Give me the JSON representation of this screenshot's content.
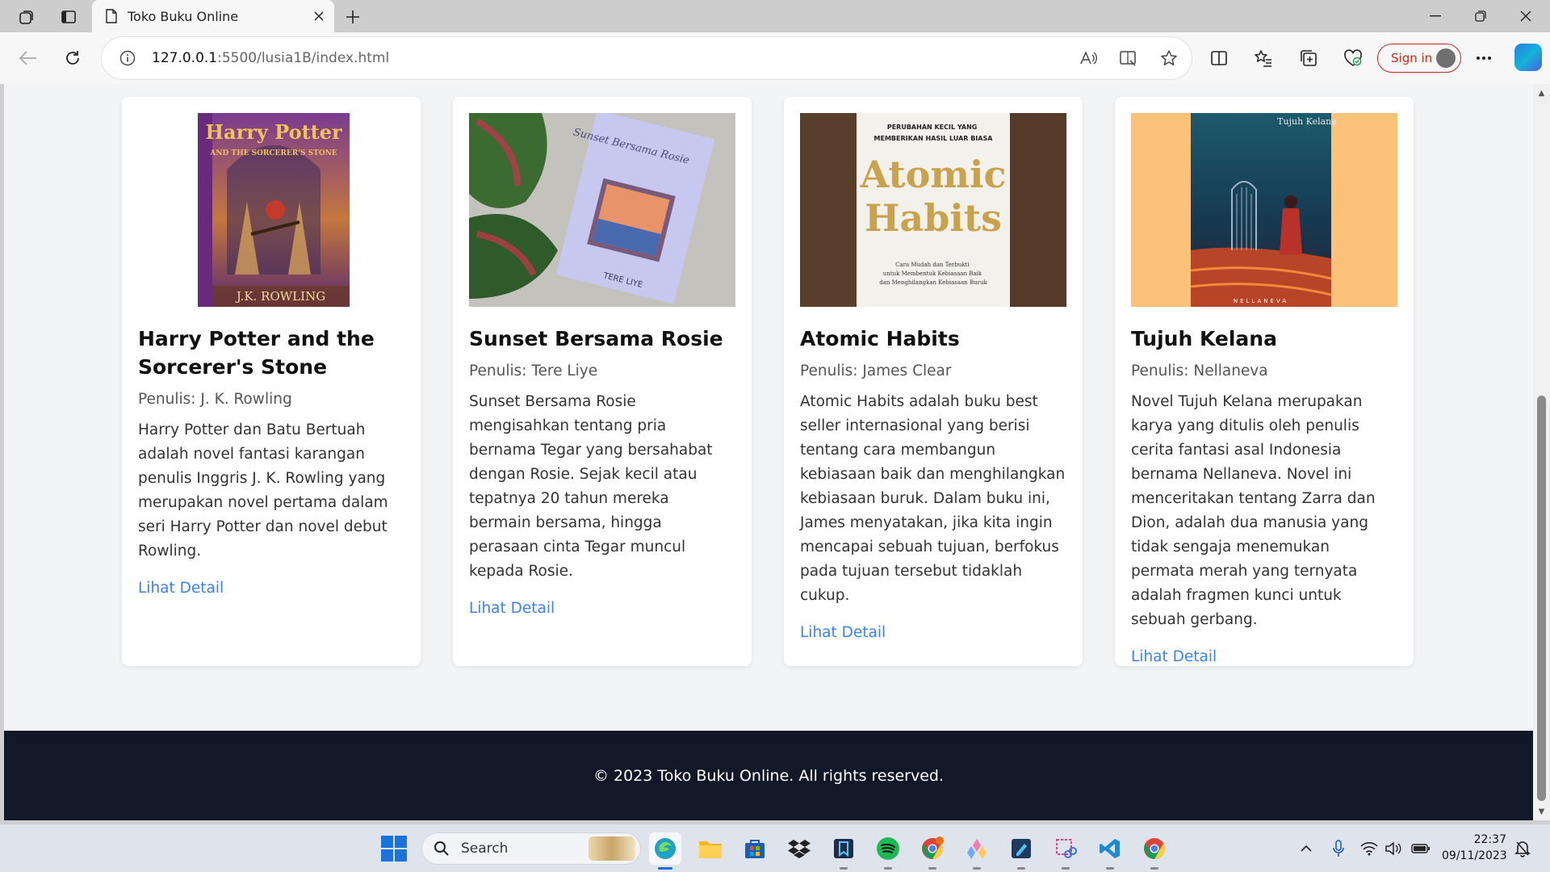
{
  "browser": {
    "tab_title": "Toko Buku Online",
    "url_host": "127.0.0.1",
    "url_rest": ":5500/lusia1B/index.html",
    "signin_label": "Sign in"
  },
  "books": [
    {
      "title": "Harry Potter and the Sorcerer's Stone",
      "author": "Penulis: J. K. Rowling",
      "description": "Harry Potter dan Batu Bertuah adalah novel fantasi karangan penulis Inggris J. K. Rowling yang merupakan novel pertama dalam seri Harry Potter dan novel debut Rowling.",
      "link": "Lihat Detail"
    },
    {
      "title": "Sunset Bersama Rosie",
      "author": "Penulis: Tere Liye",
      "description": "Sunset Bersama Rosie mengisahkan tentang pria bernama Tegar yang bersahabat dengan Rosie. Sejak kecil atau tepatnya 20 tahun mereka bermain bersama, hingga perasaan cinta Tegar muncul kepada Rosie.",
      "link": "Lihat Detail"
    },
    {
      "title": "Atomic Habits",
      "author": "Penulis: James Clear",
      "description": "Atomic Habits adalah buku best seller internasional yang berisi tentang cara membangun kebiasaan baik dan menghilangkan kebiasaan buruk. Dalam buku ini, James menyatakan, jika kita ingin mencapai sebuah tujuan, berfokus pada tujuan tersebut tidaklah cukup.",
      "link": "Lihat Detail"
    },
    {
      "title": "Tujuh Kelana",
      "author": "Penulis: Nellaneva",
      "description": "Novel Tujuh Kelana merupakan karya yang ditulis oleh penulis cerita fantasi asal Indonesia bernama Nellaneva. Novel ini menceritakan tentang Zarra dan Dion, adalah dua manusia yang tidak sengaja menemukan permata merah yang ternyata adalah fragmen kunci untuk sebuah gerbang.",
      "link": "Lihat Detail"
    }
  ],
  "covers": {
    "hp": {
      "title": "Harry Potter",
      "subtitle": "AND THE SORCERER'S STONE",
      "author": "J.K. ROWLING"
    },
    "sbr": {
      "title": "Sunset Bersama Rosie",
      "author": "TERE LIYE"
    },
    "ah": {
      "tagline": "PERUBAHAN KECIL YANG MEMBERIKAN HASIL LUAR BIASA",
      "title1": "Atomic",
      "title2": "Habits",
      "subtitle": "Cara Mudah dan Terbukti untuk Membentuk Kebiasaan Baik dan Menghilangkan Kebiasaan Buruk"
    },
    "tk": {
      "title": "Tujuh Kelana",
      "author": "NELLANEVA"
    }
  },
  "footer_text": "© 2023 Toko Buku Online. All rights reserved.",
  "taskbar": {
    "search_label": "Search",
    "time": "22:37",
    "date": "09/11/2023"
  },
  "colors": {
    "link": "#3b82f6",
    "footer_bg": "#111827",
    "page_bg": "#f3f4f6"
  }
}
